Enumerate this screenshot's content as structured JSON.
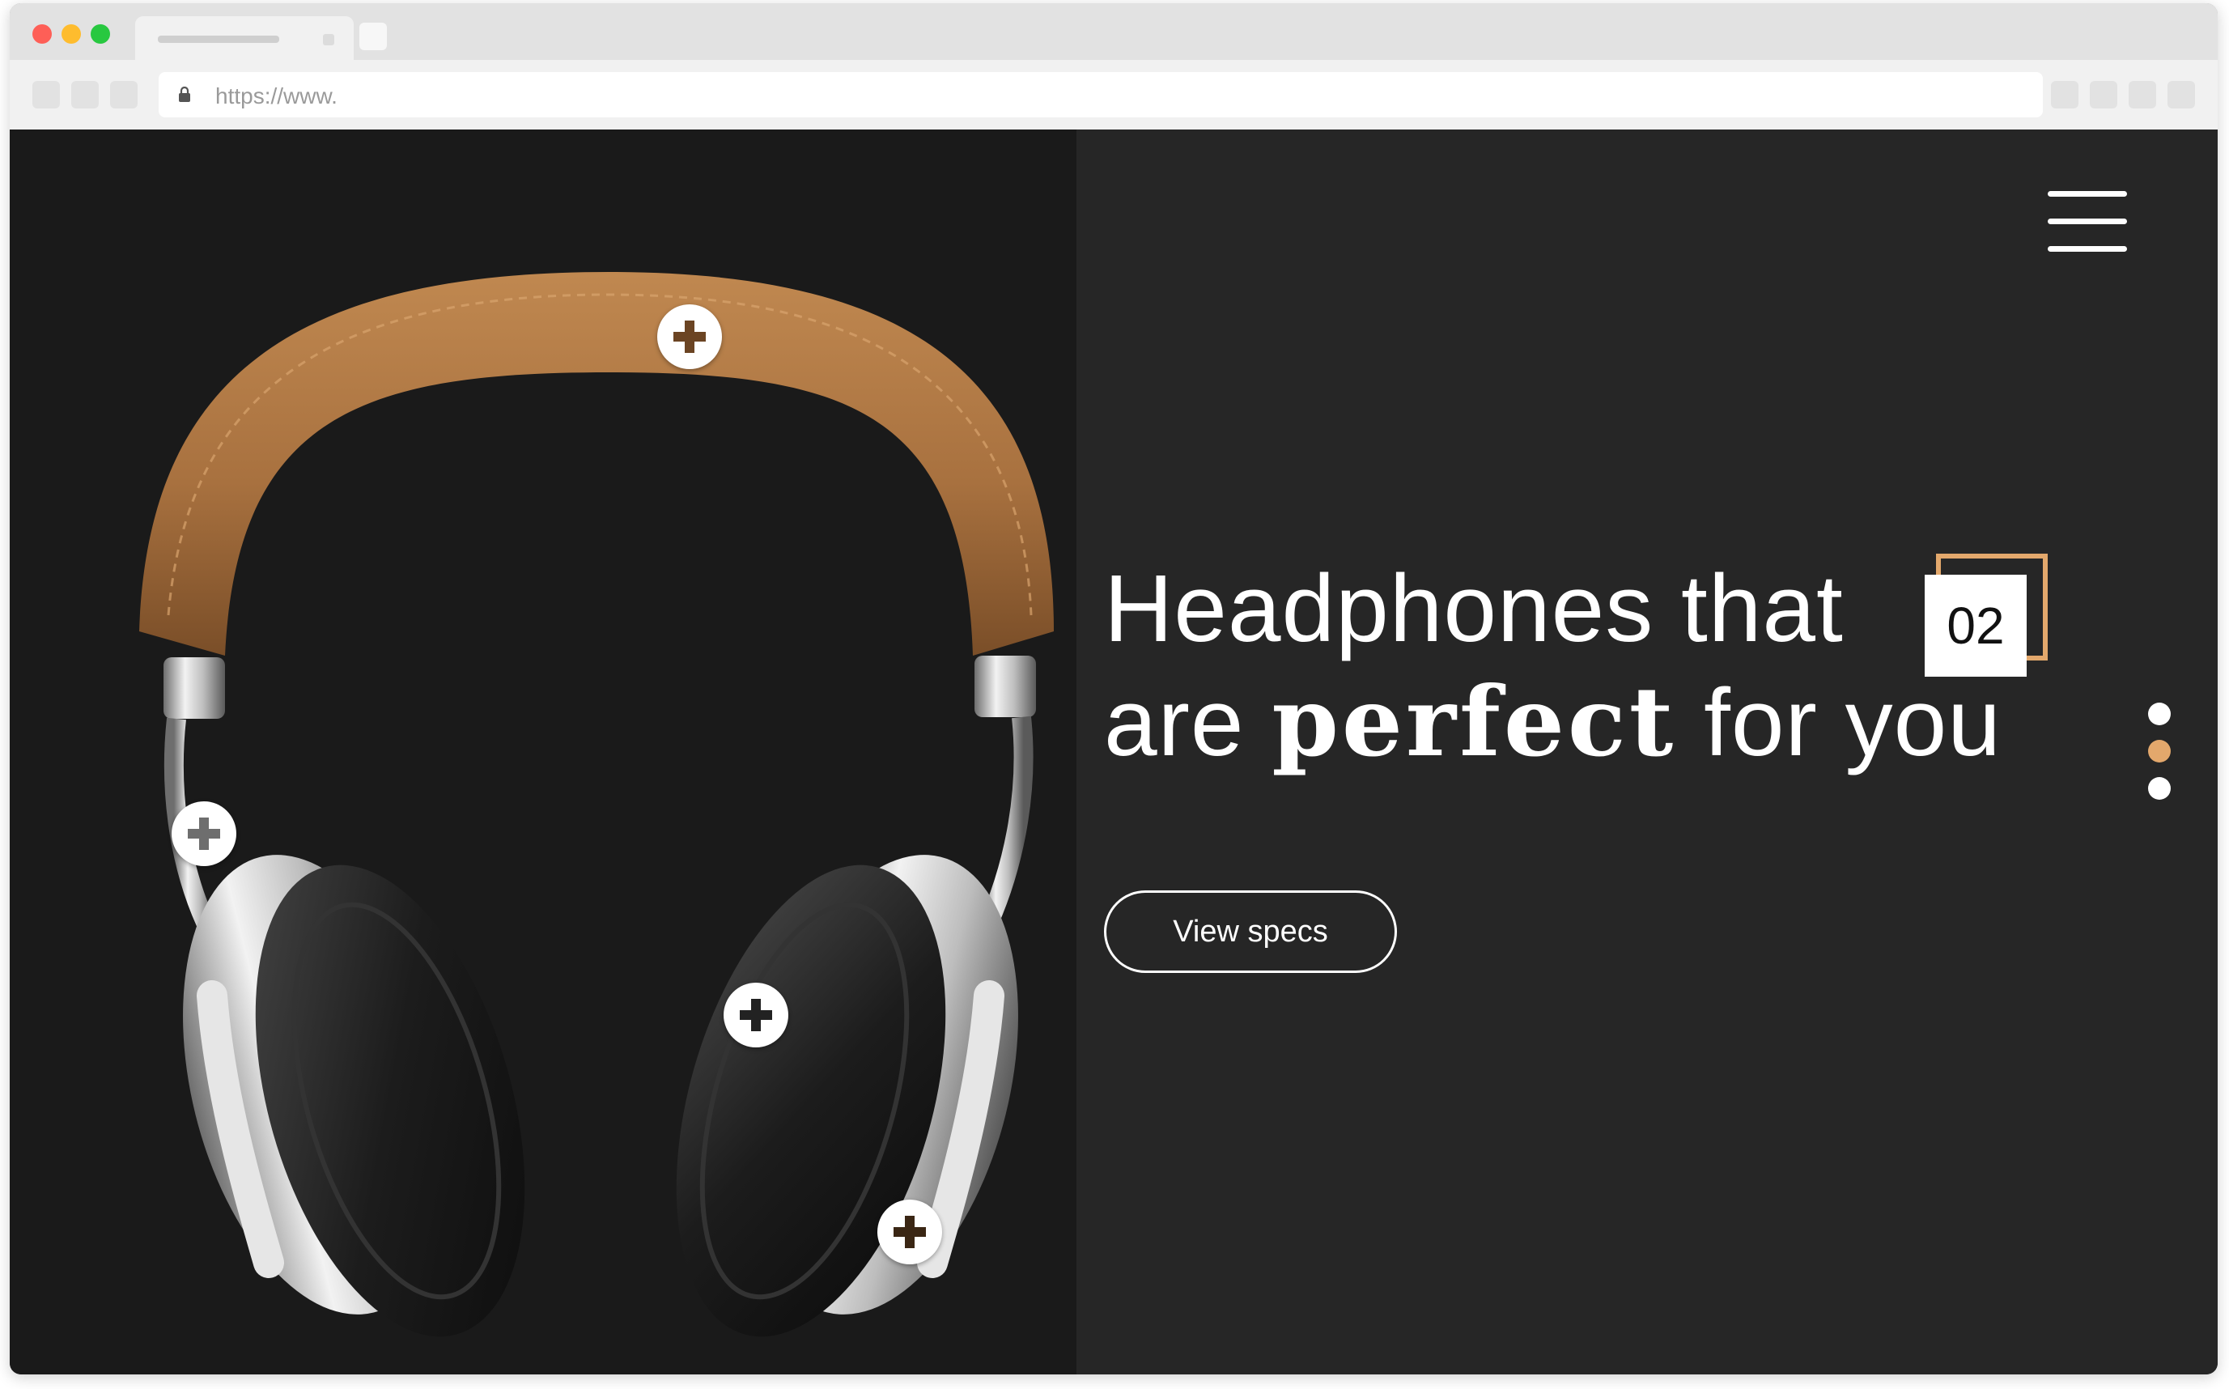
{
  "browser": {
    "url": "https://www.",
    "traffic_lights": [
      "#fe5f57",
      "#febc2e",
      "#28c840"
    ]
  },
  "hero": {
    "headline_part1": "Headphones that",
    "headline_part2_before": "are ",
    "headline_emphasis": "perfect",
    "headline_part2_after": " for you",
    "slide_number": "02",
    "cta_label": "View specs"
  },
  "pager": {
    "slide_count": 3,
    "active_slide_index": 2,
    "active_color": "#e3a86c",
    "inactive_color": "#ffffff"
  },
  "colors": {
    "left_panel_bg": "#1a1a1a",
    "right_panel_bg": "#262626",
    "accent": "#e3a86c",
    "leather": "#a8713f"
  },
  "icons": {
    "menu": "hamburger-menu-icon",
    "hotspot": "plus-icon",
    "lock": "lock-icon"
  }
}
